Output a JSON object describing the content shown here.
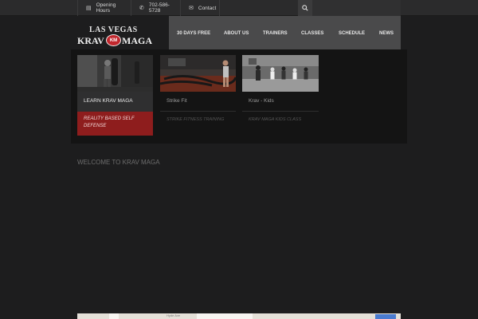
{
  "topbar": {
    "opening_hours": "Opening Hours",
    "phone": "702-586-5728",
    "contact": "Contact"
  },
  "logo": {
    "line1": "LAS VEGAS",
    "krav": "KRAV",
    "badge": "KM",
    "maga": "MAGA"
  },
  "nav": {
    "items": [
      "30 DAYS FREE",
      "ABOUT US",
      "TRAINERS",
      "CLASSES",
      "SCHEDULE",
      "NEWS"
    ]
  },
  "slider": {
    "cards": [
      {
        "title": "LEARN KRAV MAGA",
        "subtitle": "REALITY BASED SELF DEFENSE"
      },
      {
        "title": "Strike Fit",
        "subtitle": "STRIKE FITNESS TRAINING"
      },
      {
        "title": "Krav - Kids",
        "subtitle": "KRAV MAGA KIDS CLASS"
      }
    ]
  },
  "welcome": "WELCOME TO KRAV MAGA",
  "map": {
    "label": "Hyde Ave"
  },
  "colors": {
    "background": "#1d1d1e",
    "topbar": "#2b2b2c",
    "nav": "#4a4a4b",
    "accent_red": "#8e1d1d",
    "logo_badge": "#c1272d"
  }
}
